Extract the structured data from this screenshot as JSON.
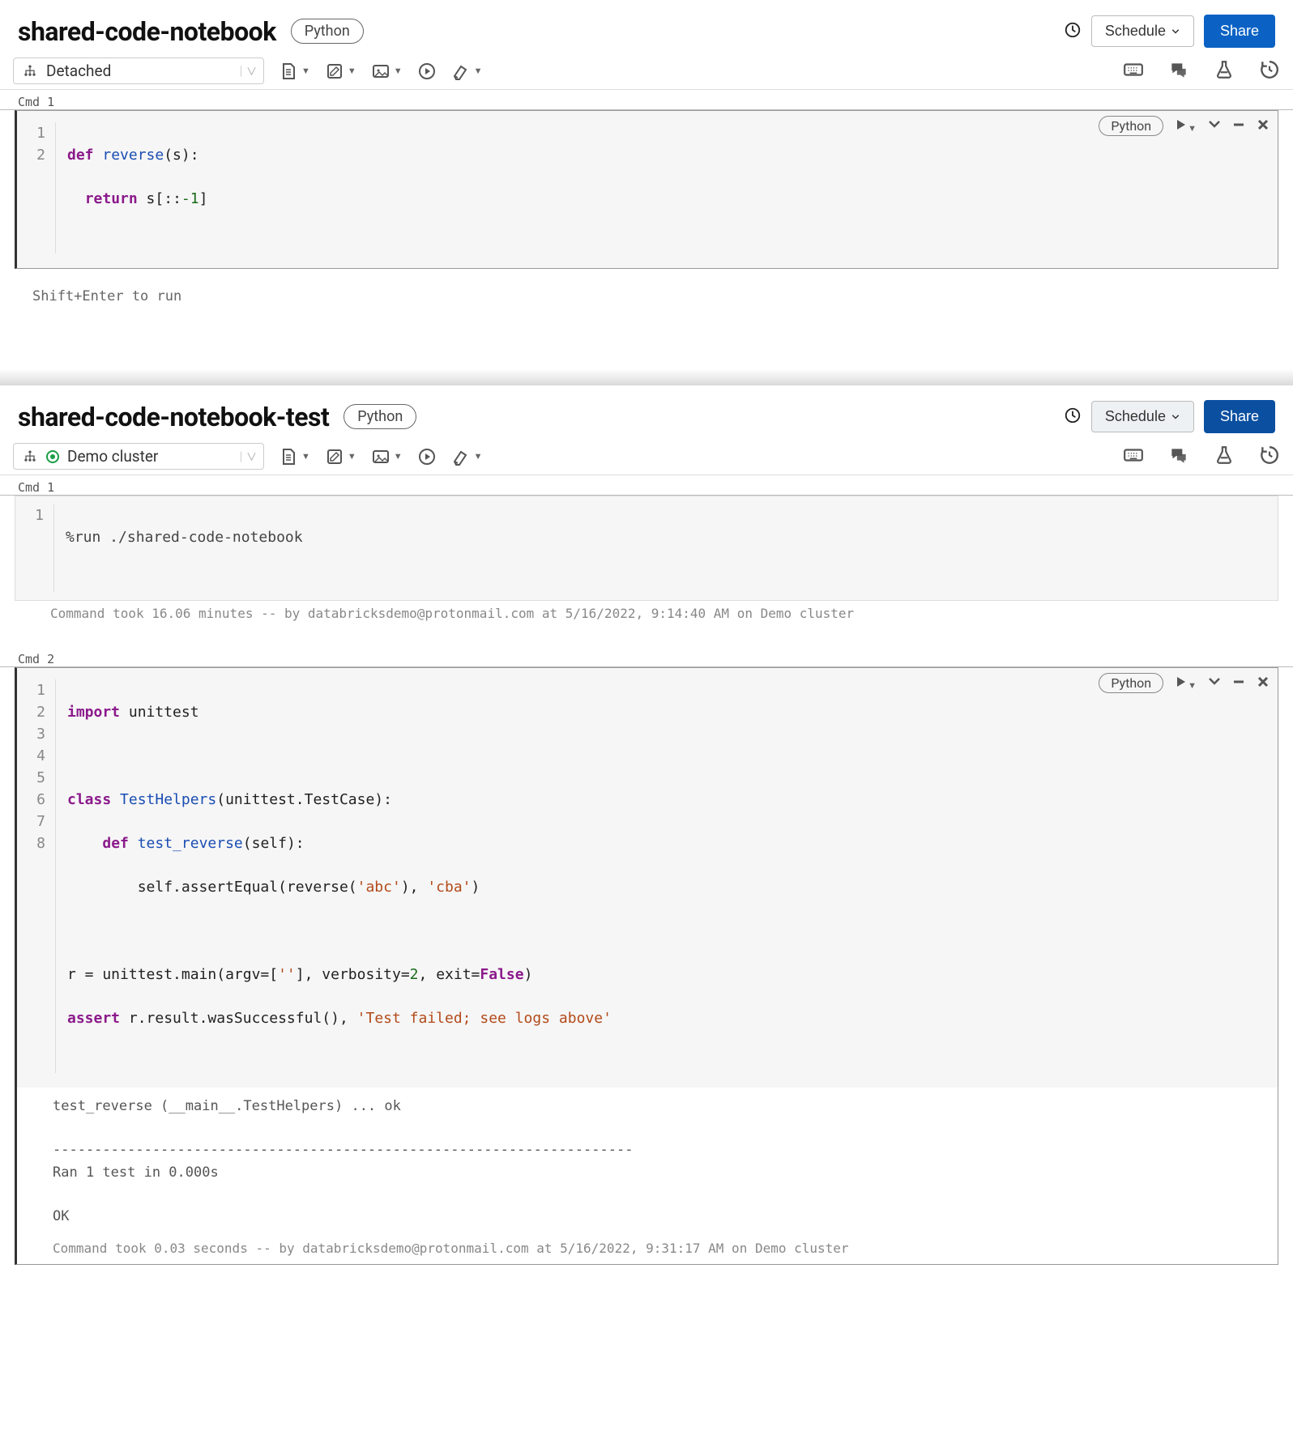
{
  "notebooks": [
    {
      "title": "shared-code-notebook",
      "language": "Python",
      "schedule_label": "Schedule",
      "share_label": "Share",
      "cluster_label": "Detached",
      "attached": false,
      "cells": [
        {
          "label": "Cmd 1",
          "lang_badge": "Python",
          "line_count": 2,
          "run_hint": "Shift+Enter to run"
        }
      ]
    },
    {
      "title": "shared-code-notebook-test",
      "language": "Python",
      "schedule_label": "Schedule",
      "share_label": "Share",
      "cluster_label": "Demo cluster",
      "attached": true,
      "cells": [
        {
          "label": "Cmd 1",
          "line_count": 1,
          "meta": "Command took 16.06 minutes -- by databricksdemo@protonmail.com at 5/16/2022, 9:14:40 AM on Demo cluster"
        },
        {
          "label": "Cmd 2",
          "lang_badge": "Python",
          "line_count": 8,
          "output": "test_reverse (__main__.TestHelpers) ... ok\n\n----------------------------------------------------------------------\nRan 1 test in 0.000s\n\nOK",
          "meta": "Command took 0.03 seconds -- by databricksdemo@protonmail.com at 5/16/2022, 9:31:17 AM on Demo cluster"
        }
      ]
    }
  ],
  "code": {
    "nb0_cell0": {
      "l1_def": "def",
      "l1_fn": "reverse",
      "l1_rest": "(s):",
      "l2_ret": "return",
      "l2_mid": " s[::",
      "l2_num": "-1",
      "l2_end": "]"
    },
    "nb1_cell0": {
      "l1": "%run ./shared-code-notebook"
    },
    "nb1_cell1": {
      "l1_kw": "import",
      "l1_mod": " unittest",
      "l3_kw": "class",
      "l3_cls": " TestHelpers",
      "l3_rest": "(unittest.TestCase):",
      "l4_kw": "def",
      "l4_fn": " test_reverse",
      "l4_rest": "(self):",
      "l5_pre": "        self.assertEqual(reverse(",
      "l5_s1": "'abc'",
      "l5_mid": "), ",
      "l5_s2": "'cba'",
      "l5_end": ")",
      "l7_pre": "r = unittest.main(argv=[",
      "l7_s1": "''",
      "l7_mid1": "], verbosity=",
      "l7_n": "2",
      "l7_mid2": ", exit=",
      "l7_b": "False",
      "l7_end": ")",
      "l8_kw": "assert",
      "l8_mid": " r.result.wasSuccessful(), ",
      "l8_s": "'Test failed; see logs above'"
    }
  }
}
